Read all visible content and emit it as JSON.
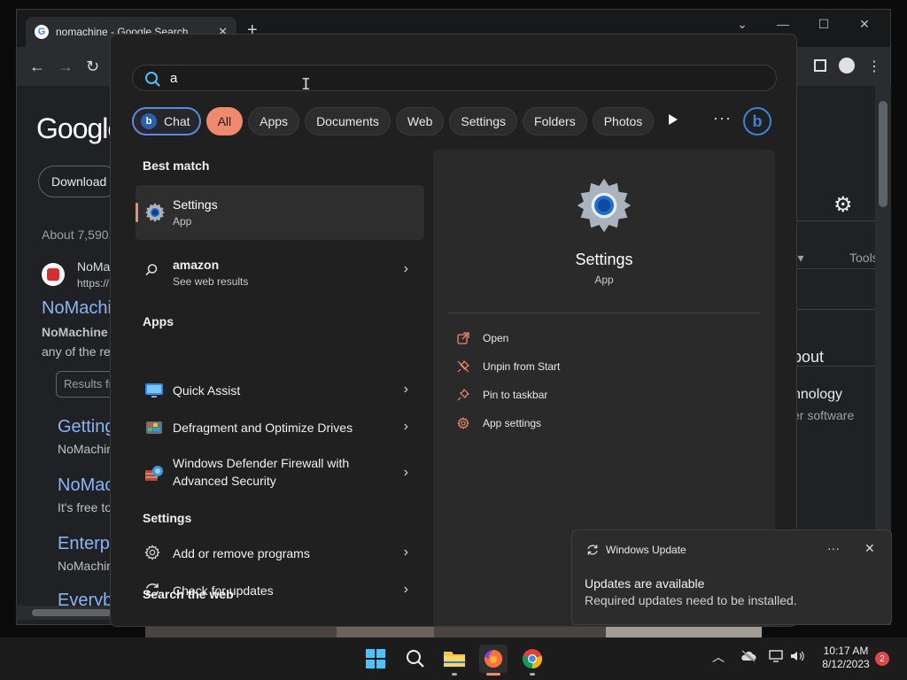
{
  "browser": {
    "tab_title": "nomachine - Google Search",
    "tab_close": "✕",
    "new_tab": "+",
    "win_min": "—",
    "win_max": "☐",
    "win_close": "✕",
    "win_chevron": "⌄",
    "back": "←",
    "forward": "→",
    "reload": "↻",
    "logo": "Google",
    "download_label": "Download",
    "result_count": "About 7,590,",
    "result_site": "NoMac",
    "result_url": "https://",
    "result_title": "NoMachi",
    "result_snip_bold": "NoMachine",
    "result_snip": "any of the re",
    "results_for": "Results fr",
    "sub1_title": "Getting",
    "sub1_snip": "NoMachin",
    "sub2_title": "NoMac",
    "sub2_snip": "It's free to",
    "sub3_title": "Enterp",
    "sub3_snip": "NoMachin",
    "sub4_title": "Everyb",
    "tools_partial": "rs ▾",
    "tools": "Tools",
    "about_partial": "bout",
    "tech_partial": "nnology",
    "software_partial": "er software"
  },
  "search": {
    "query": "a",
    "cursor": "I"
  },
  "filters": {
    "chat": "Chat",
    "chat_b": "b",
    "items": [
      "All",
      "Apps",
      "Documents",
      "Web",
      "Settings",
      "Folders",
      "Photos"
    ],
    "more": "···",
    "bing": "b"
  },
  "best_match": {
    "heading": "Best match",
    "name": "Settings",
    "sub": "App"
  },
  "web_row": {
    "name": "amazon",
    "sub": "See web results"
  },
  "apps": {
    "heading": "Apps",
    "items": [
      "Quick Assist",
      "Defragment and Optimize Drives"
    ],
    "firewall_line1": "Windows Defender Firewall with",
    "firewall_line2": "Advanced Security"
  },
  "settings_section": {
    "heading": "Settings",
    "items": [
      "Add or remove programs",
      "Check for updates"
    ]
  },
  "search_web": {
    "heading": "Search the web"
  },
  "chevron": "›",
  "detail": {
    "title": "Settings",
    "sub": "App",
    "actions": [
      "Open",
      "Unpin from Start",
      "Pin to taskbar",
      "App settings"
    ]
  },
  "toast": {
    "app": "Windows Update",
    "more": "···",
    "close": "✕",
    "title": "Updates are available",
    "body": "Required updates need to be installed."
  },
  "taskbar": {
    "time": "10:17 AM",
    "date": "8/12/2023",
    "notification_count": "2",
    "tray_chevron": "︿"
  },
  "colors": {
    "accent": "#f08a6e",
    "bing_blue": "#3b82d9",
    "settings_blue": "#1f6fd1"
  }
}
